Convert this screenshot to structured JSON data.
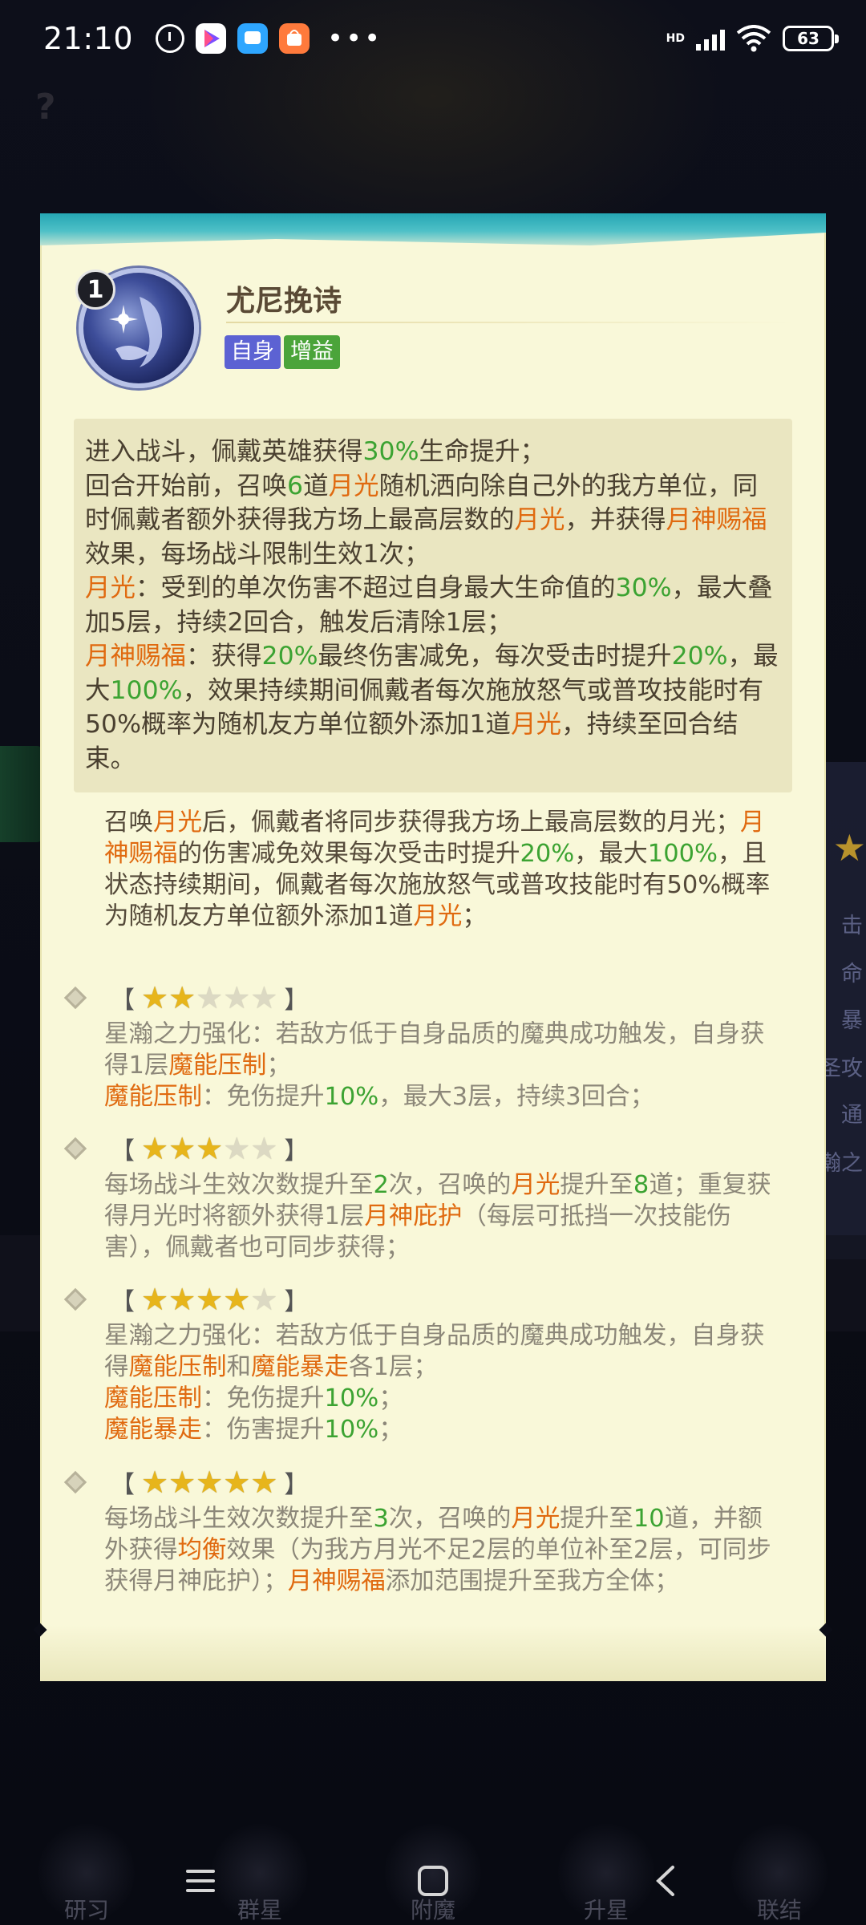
{
  "status_bar": {
    "time": "21:10",
    "network_label": "HD",
    "battery": "63"
  },
  "background": {
    "question_mark": "?",
    "right_panel_chars": [
      "击",
      "命",
      "暴",
      "圣攻",
      "通",
      "瀚之"
    ],
    "bottom_labels": [
      "研习",
      "群星",
      "附魔",
      "升星",
      "联结"
    ]
  },
  "card": {
    "level": "1",
    "title": "尤尼挽诗",
    "tags": [
      "自身",
      "增益"
    ],
    "description": [
      [
        {
          "t": "进入战斗，佩戴英雄获得"
        },
        {
          "t": "30%",
          "c": "g"
        },
        {
          "t": "生命提升；"
        }
      ],
      [
        {
          "t": "回合开始前，召唤"
        },
        {
          "t": "6",
          "c": "g"
        },
        {
          "t": "道"
        },
        {
          "t": "月光",
          "c": "o"
        },
        {
          "t": "随机洒向除自己外的我方单位，同时佩戴者额外获得我方场上最高层数的"
        },
        {
          "t": "月光",
          "c": "o"
        },
        {
          "t": "，并获得"
        },
        {
          "t": "月神赐福",
          "c": "o"
        },
        {
          "t": "效果，每场战斗限制生效1次；"
        }
      ],
      [
        {
          "t": "月光",
          "c": "o"
        },
        {
          "t": "：受到的单次伤害不超过自身最大生命值的"
        },
        {
          "t": "30%",
          "c": "g"
        },
        {
          "t": "，最大叠加5层，持续2回合，触发后清除1层；"
        }
      ],
      [
        {
          "t": "月神赐福",
          "c": "o"
        },
        {
          "t": "：获得"
        },
        {
          "t": "20%",
          "c": "g"
        },
        {
          "t": "最终伤害减免，每次受击时提升"
        },
        {
          "t": "20%",
          "c": "g"
        },
        {
          "t": "，最大"
        },
        {
          "t": "100%",
          "c": "g"
        },
        {
          "t": "，效果持续期间佩戴者每次施放怒气或普攻技能时有50%概率为随机友方单位额外添加1道"
        },
        {
          "t": "月光",
          "c": "o"
        },
        {
          "t": "，持续至回合结束。"
        }
      ]
    ],
    "base_upgrade": [
      {
        "t": "召唤"
      },
      {
        "t": "月光",
        "c": "o"
      },
      {
        "t": "后，佩戴者将同步获得我方场上最高层数的月光；"
      },
      {
        "t": "月神赐福",
        "c": "o"
      },
      {
        "t": "的伤害减免效果每次受击时提升"
      },
      {
        "t": "20%",
        "c": "g"
      },
      {
        "t": "，最大"
      },
      {
        "t": "100%",
        "c": "g"
      },
      {
        "t": "，且状态持续期间，佩戴者每次施放怒气或普攻技能时有50%概率为随机友方单位额外添加1道"
      },
      {
        "t": "月光",
        "c": "o"
      },
      {
        "t": "；"
      }
    ],
    "star_levels": [
      {
        "stars": 2,
        "bracket_open": "【",
        "bracket_close": "】",
        "text": [
          [
            {
              "t": "星瀚之力强化：若敌方低于自身品质的魔典成功触发，自身获得1层"
            },
            {
              "t": "魔能压制",
              "c": "o"
            },
            {
              "t": "；"
            }
          ],
          [
            {
              "t": "魔能压制",
              "c": "o"
            },
            {
              "t": "：免伤提升"
            },
            {
              "t": "10%",
              "c": "g"
            },
            {
              "t": "，最大3层，持续3回合；"
            }
          ]
        ]
      },
      {
        "stars": 3,
        "bracket_open": "【",
        "bracket_close": "】",
        "text": [
          [
            {
              "t": "每场战斗生效次数提升至"
            },
            {
              "t": "2",
              "c": "g"
            },
            {
              "t": "次，召唤的"
            },
            {
              "t": "月光",
              "c": "o"
            },
            {
              "t": "提升至"
            },
            {
              "t": "8",
              "c": "g"
            },
            {
              "t": "道；重复获得月光时将额外获得1层"
            },
            {
              "t": "月神庇护",
              "c": "o"
            },
            {
              "t": "（每层可抵挡一次技能伤害），佩戴者也可同步获得；"
            }
          ]
        ]
      },
      {
        "stars": 4,
        "bracket_open": "【",
        "bracket_close": "】",
        "text": [
          [
            {
              "t": "星瀚之力强化：若敌方低于自身品质的魔典成功触发，自身获得"
            },
            {
              "t": "魔能压制",
              "c": "o"
            },
            {
              "t": "和"
            },
            {
              "t": "魔能暴走",
              "c": "o"
            },
            {
              "t": "各1层；"
            }
          ],
          [
            {
              "t": "魔能压制",
              "c": "o"
            },
            {
              "t": "：免伤提升"
            },
            {
              "t": "10%",
              "c": "g"
            },
            {
              "t": "；"
            }
          ],
          [
            {
              "t": "魔能暴走",
              "c": "o"
            },
            {
              "t": "：伤害提升"
            },
            {
              "t": "10%",
              "c": "g"
            },
            {
              "t": "；"
            }
          ]
        ]
      },
      {
        "stars": 5,
        "bracket_open": "【",
        "bracket_close": "】",
        "text": [
          [
            {
              "t": "每场战斗生效次数提升至"
            },
            {
              "t": "3",
              "c": "g"
            },
            {
              "t": "次，召唤的"
            },
            {
              "t": "月光",
              "c": "o"
            },
            {
              "t": "提升至"
            },
            {
              "t": "10",
              "c": "g"
            },
            {
              "t": "道，并额外获得"
            },
            {
              "t": "均衡",
              "c": "o"
            },
            {
              "t": "效果（为我方月光不足2层的单位补至2层，可同步获得月神庇护）；"
            },
            {
              "t": "月神赐福",
              "c": "o"
            },
            {
              "t": "添加范围提升至我方全体；"
            }
          ]
        ]
      }
    ],
    "colors": {
      "highlight_orange": "#e06a10",
      "highlight_green": "#3ca332",
      "star_on": "#e7b51b",
      "tag_self": "#5c62d3",
      "tag_buff": "#4ba43a"
    }
  }
}
